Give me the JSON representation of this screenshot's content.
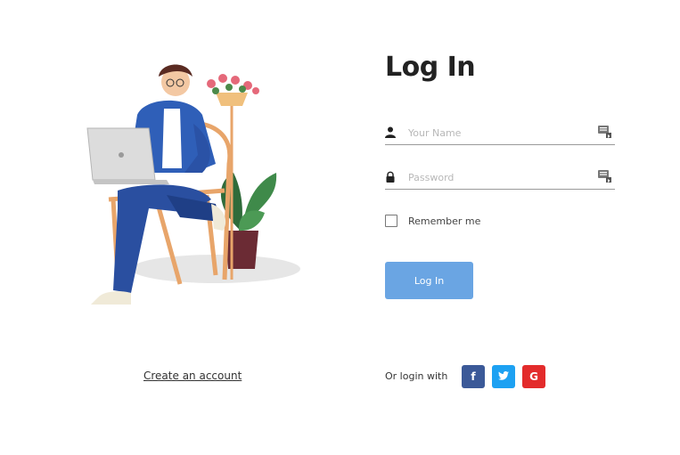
{
  "login": {
    "title": "Log In",
    "name_field": {
      "placeholder": "Your Name",
      "value": "",
      "icon": "user-icon"
    },
    "password_field": {
      "placeholder": "Password",
      "value": "",
      "icon": "lock-icon"
    },
    "remember_label": "Remember me",
    "remember_checked": false,
    "login_button": "Log In",
    "button_color": "#6aa5e3"
  },
  "footer": {
    "create_account": "Create an account",
    "or_login_with": "Or login with",
    "social": [
      {
        "name": "facebook",
        "glyph": "f",
        "color": "#3b5998"
      },
      {
        "name": "twitter",
        "glyph": "t",
        "color": "#1da1f2"
      },
      {
        "name": "google",
        "glyph": "G",
        "color": "#e32b2b"
      }
    ]
  }
}
